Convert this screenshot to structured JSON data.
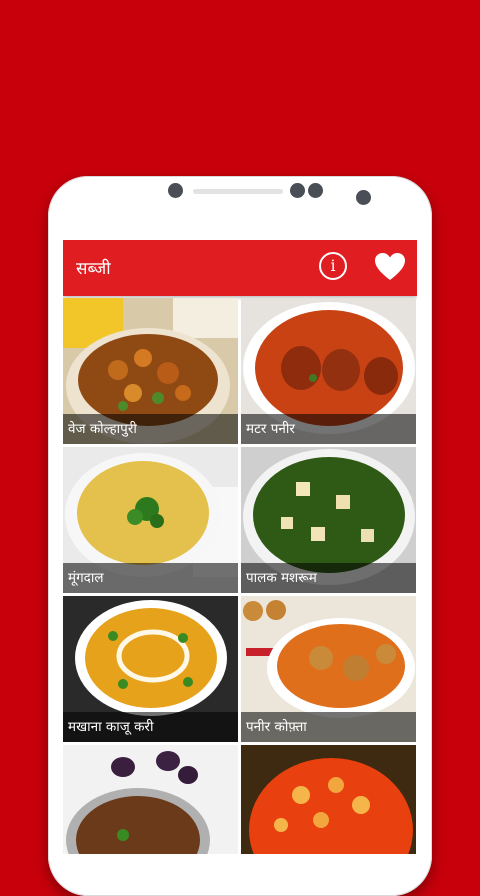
{
  "app": {
    "title": "सब्जी"
  },
  "toolbar": {
    "info_icon": "info-icon",
    "info_glyph": "i",
    "favorite_icon": "heart-icon"
  },
  "recipes": [
    {
      "name": "वेज कोल्हापुरी"
    },
    {
      "name": "मटर पनीर"
    },
    {
      "name": "मूंगदाल"
    },
    {
      "name": "पालक मशरूम"
    },
    {
      "name": "मखाना काजू करी"
    },
    {
      "name": "पनीर कोफ़्ता"
    },
    {
      "name": ""
    },
    {
      "name": ""
    }
  ],
  "colors": {
    "background": "#c8000b",
    "appbar": "#e01d21",
    "phone": "#ffffff"
  }
}
